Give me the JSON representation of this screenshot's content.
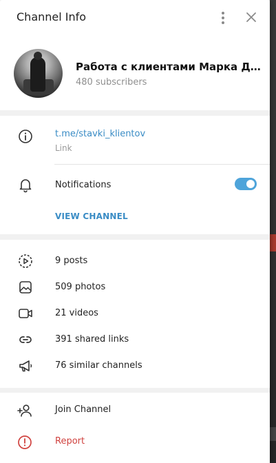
{
  "header": {
    "title": "Channel Info"
  },
  "channel": {
    "name": "Работа с клиентами Марка Дорохова",
    "subscribers": "480 subscribers"
  },
  "info": {
    "link": "t.me/stavki_klientov",
    "link_label": "Link",
    "notifications_label": "Notifications",
    "notifications_on": true,
    "view_channel": "VIEW CHANNEL"
  },
  "stats": {
    "posts": "9 posts",
    "photos": "509 photos",
    "videos": "21 videos",
    "links": "391 shared links",
    "similar": "76 similar channels"
  },
  "actions": {
    "join": "Join Channel",
    "report": "Report"
  },
  "colors": {
    "accent": "#3a8cc5",
    "toggle": "#4ea4da",
    "danger": "#d0423f"
  }
}
